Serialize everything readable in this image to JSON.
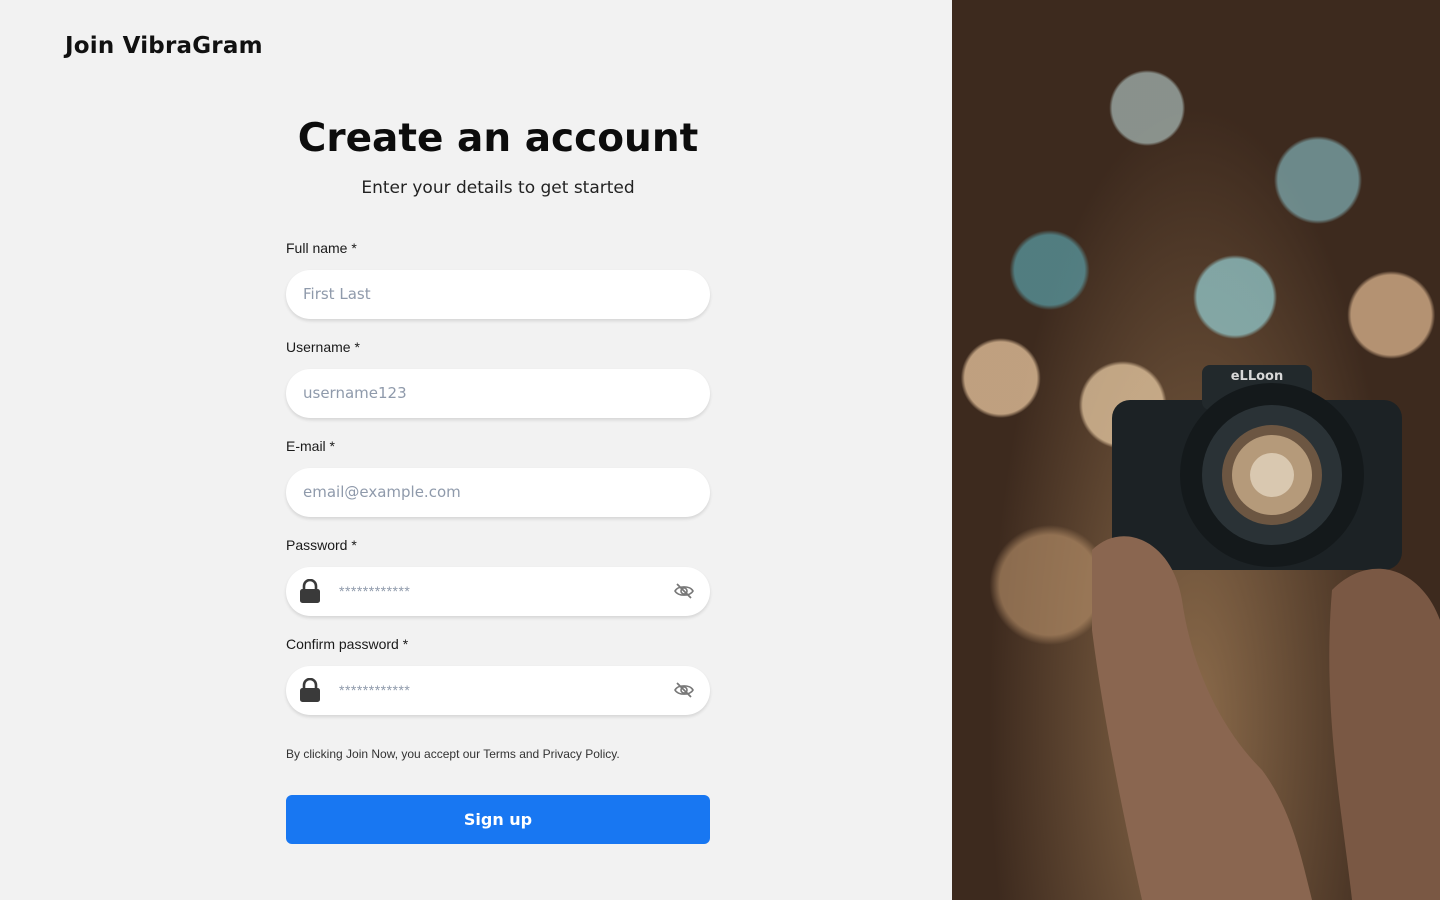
{
  "brand": {
    "title": "Join VibraGram"
  },
  "form": {
    "heading": "Create an account",
    "subheading": "Enter your details to get started",
    "full_name": {
      "label": "Full name *",
      "placeholder": "First Last"
    },
    "username": {
      "label": "Username *",
      "placeholder": "username123"
    },
    "email": {
      "label": "E-mail *",
      "placeholder": "email@example.com"
    },
    "password": {
      "label": "Password *",
      "placeholder": "************"
    },
    "confirm_password": {
      "label": "Confirm password *",
      "placeholder": "************"
    },
    "terms": "By clicking Join Now, you accept our Terms and Privacy Policy.",
    "submit_label": "Sign up"
  },
  "hero": {
    "camera_brand": "eLLoon"
  },
  "icons": {
    "lock": "lock-icon",
    "eye_off": "eye-off-icon"
  },
  "colors": {
    "accent": "#1877f2",
    "background": "#f2f2f2",
    "placeholder": "#8f9aab"
  }
}
